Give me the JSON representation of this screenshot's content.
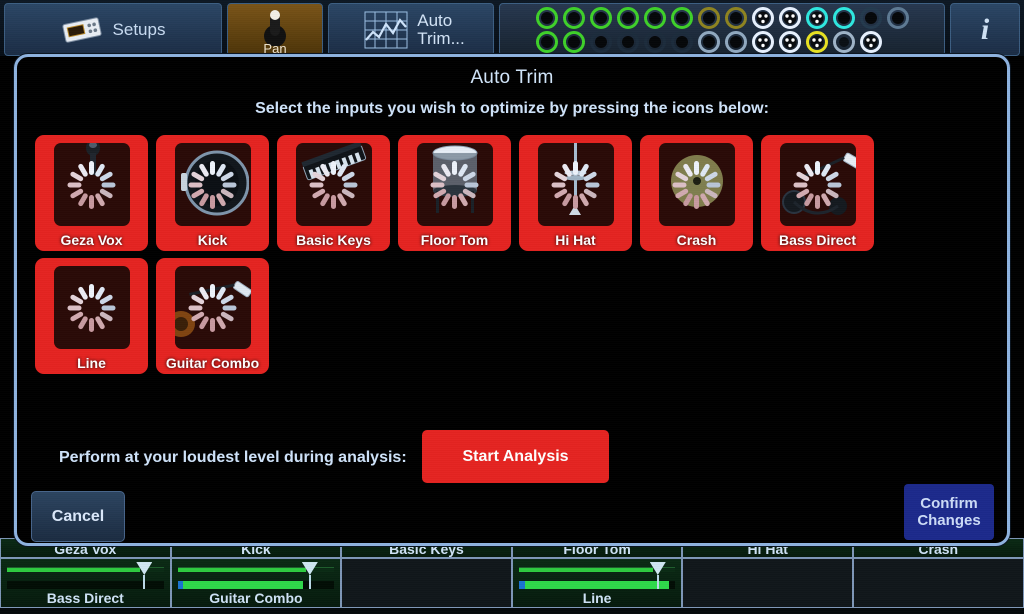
{
  "toolbar": {
    "setups_label": "Setups",
    "setups_icon": "mixer-console-icon",
    "pan_label": "Pan",
    "pan_icon": "pan-knob-icon",
    "auto_trim_line1": "Auto",
    "auto_trim_line2": "Trim...",
    "auto_trim_icon": "waveform-grid-icon",
    "info_label": "i",
    "info_icon": "info-icon",
    "jacks": {
      "row1": [
        {
          "name": "jack-1",
          "color": "#3fd12a",
          "type": "xlr"
        },
        {
          "name": "jack-2",
          "color": "#3fd12a",
          "type": "xlr"
        },
        {
          "name": "jack-3",
          "color": "#3fd12a",
          "type": "xlr"
        },
        {
          "name": "jack-4",
          "color": "#3fd12a",
          "type": "xlr"
        },
        {
          "name": "jack-5",
          "color": "#3fd12a",
          "type": "xlr"
        },
        {
          "name": "jack-6",
          "color": "#3fd12a",
          "type": "xlr"
        },
        {
          "name": "jack-7",
          "color": "#8f8420",
          "type": "xlr"
        },
        {
          "name": "jack-8",
          "color": "#8f8420",
          "type": "xlr"
        },
        {
          "name": "jack-9",
          "color": "#e8f2ff",
          "type": "trs"
        },
        {
          "name": "jack-10",
          "color": "#e8f2ff",
          "type": "trs"
        },
        {
          "name": "jack-11",
          "color": "#2fe8e0",
          "type": "trs"
        },
        {
          "name": "jack-12",
          "color": "#2fe8e0",
          "type": "xlr"
        },
        {
          "name": "jack-13",
          "color": "#243a4e",
          "type": "xlr"
        },
        {
          "name": "jack-14",
          "color": "#5e7a94",
          "type": "xlr"
        }
      ],
      "row2": [
        {
          "name": "jack-15",
          "color": "#3fd12a",
          "type": "xlr"
        },
        {
          "name": "jack-16",
          "color": "#3fd12a",
          "type": "xlr"
        },
        {
          "name": "jack-17",
          "color": "#1c2c3c",
          "type": "xlr"
        },
        {
          "name": "jack-18",
          "color": "#1c2c3c",
          "type": "xlr"
        },
        {
          "name": "jack-19",
          "color": "#1c2c3c",
          "type": "xlr"
        },
        {
          "name": "jack-20",
          "color": "#1c2c3c",
          "type": "xlr"
        },
        {
          "name": "jack-21",
          "color": "#91a9c0",
          "type": "xlr"
        },
        {
          "name": "jack-22",
          "color": "#91a9c0",
          "type": "xlr"
        },
        {
          "name": "jack-23",
          "color": "#e8f2ff",
          "type": "trs"
        },
        {
          "name": "jack-24",
          "color": "#e8f2ff",
          "type": "trs"
        },
        {
          "name": "jack-25",
          "color": "#e8e222",
          "type": "trs"
        },
        {
          "name": "jack-26",
          "color": "#9fb4c8",
          "type": "plain"
        },
        {
          "name": "jack-27",
          "color": "#e8f2ff",
          "type": "trs"
        }
      ]
    }
  },
  "dialog": {
    "title": "Auto Trim",
    "subtitle": "Select the inputs you wish to optimize by pressing the icons below:",
    "hint": "Perform at your loudest level during analysis:",
    "start_label": "Start Analysis",
    "cancel_label": "Cancel",
    "confirm_line1": "Confirm",
    "confirm_line2": "Changes",
    "selected_color": "#e52421",
    "tiles": [
      {
        "label": "Geza Vox",
        "icon": "microphone-icon",
        "selected": true
      },
      {
        "label": "Kick",
        "icon": "kick-drum-icon",
        "selected": true
      },
      {
        "label": "Basic Keys",
        "icon": "keyboard-icon",
        "selected": true
      },
      {
        "label": "Floor Tom",
        "icon": "floor-tom-icon",
        "selected": true
      },
      {
        "label": "Hi Hat",
        "icon": "hi-hat-icon",
        "selected": true
      },
      {
        "label": "Crash",
        "icon": "crash-cymbal-icon",
        "selected": true
      },
      {
        "label": "Bass Direct",
        "icon": "di-box-icon",
        "selected": true
      },
      {
        "label": "Line",
        "icon": "line-input-icon",
        "selected": true
      },
      {
        "label": "Guitar Combo",
        "icon": "guitar-amp-icon",
        "selected": true
      }
    ]
  },
  "mixer": {
    "top_row": [
      {
        "label": "Geza Vox",
        "empty": false
      },
      {
        "label": "Kick",
        "empty": false
      },
      {
        "label": "Basic Keys",
        "empty": false
      },
      {
        "label": "Floor Tom",
        "empty": false
      },
      {
        "label": "Hi Hat",
        "empty": false
      },
      {
        "label": "Crash",
        "empty": false
      }
    ],
    "bottom_row": [
      {
        "label": "Bass Direct",
        "empty": false,
        "fader": 85,
        "meter": 0
      },
      {
        "label": "Guitar Combo",
        "empty": false,
        "fader": 82,
        "meter": 80
      },
      {
        "label": "",
        "empty": true,
        "fader": 0,
        "meter": 0
      },
      {
        "label": "Line",
        "empty": false,
        "fader": 86,
        "meter": 96
      },
      {
        "label": "",
        "empty": true,
        "fader": 0,
        "meter": 0
      },
      {
        "label": "",
        "empty": true,
        "fader": 0,
        "meter": 0
      }
    ]
  }
}
